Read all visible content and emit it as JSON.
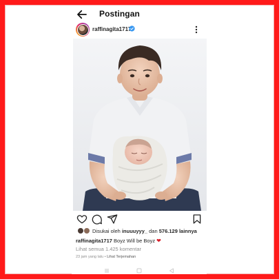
{
  "header": {
    "title": "Postingan"
  },
  "post": {
    "username": "raffinagita1717",
    "likes": {
      "prefix": "Disukai oleh",
      "liker": "inuuuyyy_",
      "conjunction": "dan",
      "count": "576.129 lainnya"
    },
    "caption": {
      "username": "raffinagita1717",
      "text": "Boyz Will be Boyz"
    },
    "comments_link": "Lihat semua 1.425 komentar",
    "time_ago": "23 jam yang lalu",
    "separator": "•",
    "translate_label": "Lihat Terjemahan"
  },
  "icons": {
    "back": "arrow-left-icon",
    "verified": "verified-badge-icon",
    "more": "more-vertical-icon",
    "like": "heart-icon",
    "comment": "comment-icon",
    "share": "send-icon",
    "save": "bookmark-icon",
    "caption_emoji": "red-heart-icon"
  },
  "colors": {
    "frame": "#ff1a1a",
    "verified": "#3897f0",
    "heart": "#d81f2a",
    "muted_text": "#8e8e8e"
  }
}
